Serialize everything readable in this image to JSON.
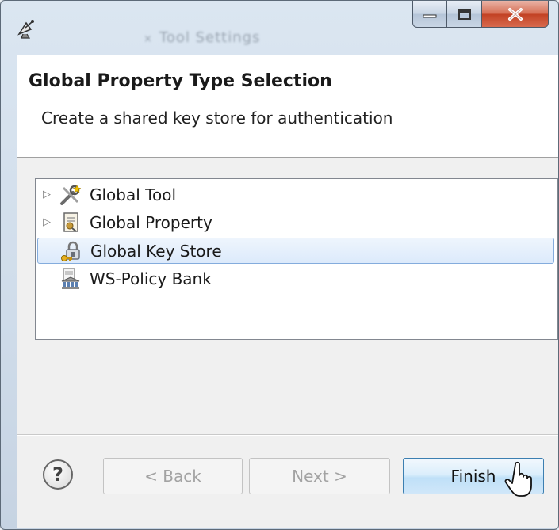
{
  "window": {
    "background_title": "Tool Settings",
    "background_close_glyph": "×",
    "caption_buttons": [
      "minimize",
      "maximize",
      "close"
    ]
  },
  "header": {
    "title": "Global Property Type Selection",
    "description": "Create a shared key store for authentication"
  },
  "tree": {
    "items": [
      {
        "label": "Global Tool",
        "expandable": true,
        "icon": "tools-icon",
        "selected": false
      },
      {
        "label": "Global Property",
        "expandable": true,
        "icon": "property-document-icon",
        "selected": false
      },
      {
        "label": "Global Key Store",
        "expandable": false,
        "icon": "lock-key-icon",
        "selected": true
      },
      {
        "label": "WS-Policy Bank",
        "expandable": false,
        "icon": "policy-bank-icon",
        "selected": false
      }
    ]
  },
  "help_glyph": "?",
  "buttons": {
    "back": "< Back",
    "next": "Next >",
    "finish": "Finish"
  },
  "colors": {
    "selection_border": "#84acdd",
    "finish_border": "#3c7fb1",
    "close_button": "#c24224"
  }
}
